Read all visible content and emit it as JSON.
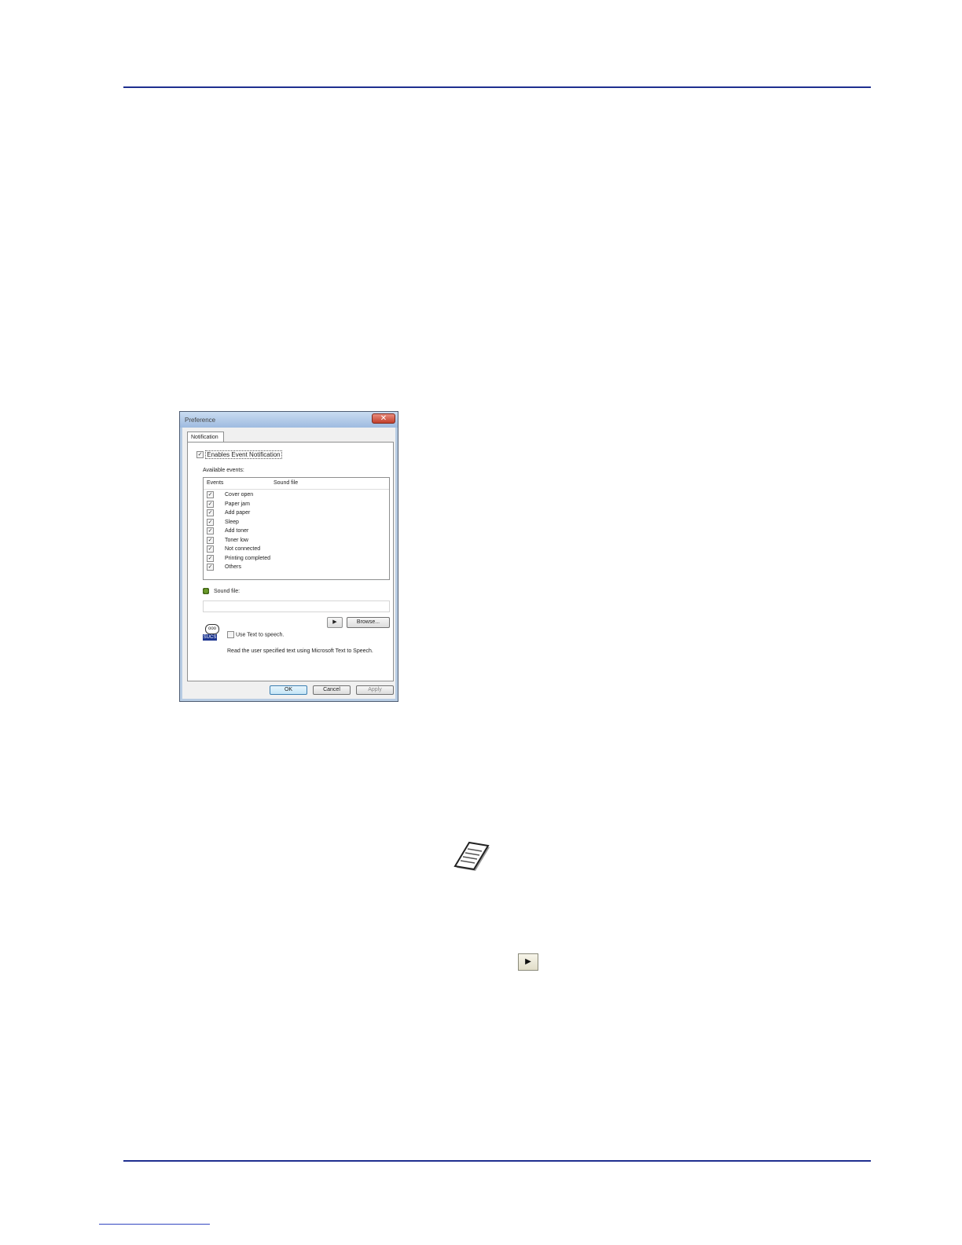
{
  "dialog": {
    "title": "Preference",
    "close_glyph": "✕",
    "tab_label": "Notification",
    "enable_label": "Enables Event Notification",
    "enable_checked": true,
    "available_label": "Available events:",
    "columns": {
      "events": "Events",
      "sound_file": "Sound file"
    },
    "events": [
      {
        "label": "Cover open",
        "checked": true
      },
      {
        "label": "Paper jam",
        "checked": true
      },
      {
        "label": "Add paper",
        "checked": true
      },
      {
        "label": "Sleep",
        "checked": true
      },
      {
        "label": "Add toner",
        "checked": true
      },
      {
        "label": "Toner low",
        "checked": true
      },
      {
        "label": "Not connected",
        "checked": true
      },
      {
        "label": "Printing completed",
        "checked": true
      },
      {
        "label": "Others",
        "checked": true
      }
    ],
    "sound_file_label": "Sound file:",
    "sound_file_value": "",
    "play_glyph": "▶",
    "browse_label": "Browse...",
    "tts_bubble": "ooo",
    "tts_box": "SUCS",
    "tts_label": "Use Text to speech.",
    "tts_checked": false,
    "tts_description": "Read the user specified text using Microsoft Text to Speech.",
    "ok_label": "OK",
    "cancel_label": "Cancel",
    "apply_label": "Apply"
  },
  "play_button": {
    "glyph": "▶"
  },
  "icons": {
    "note": "note-icon",
    "speaker": "speaker-icon",
    "tts": "text-to-speech-icon",
    "play": "play-icon"
  },
  "colors": {
    "rule": "#1f2f8f",
    "dialog_frame": "#b7cce3",
    "ok_button": "#c4e5f6"
  }
}
